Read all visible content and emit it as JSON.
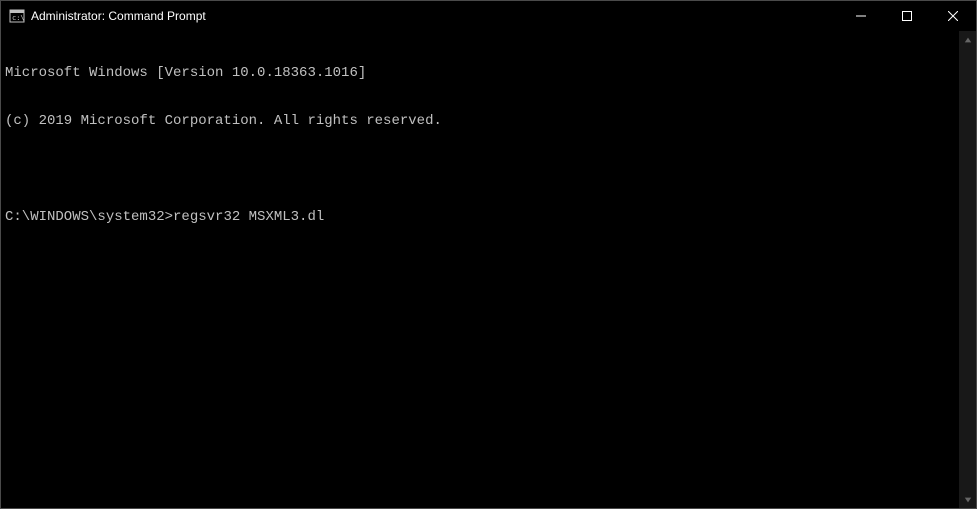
{
  "window": {
    "title": "Administrator: Command Prompt"
  },
  "terminal": {
    "line1": "Microsoft Windows [Version 10.0.18363.1016]",
    "line2": "(c) 2019 Microsoft Corporation. All rights reserved.",
    "blank": "",
    "prompt": "C:\\WINDOWS\\system32>",
    "command": "regsvr32 MSXML3.dl"
  }
}
